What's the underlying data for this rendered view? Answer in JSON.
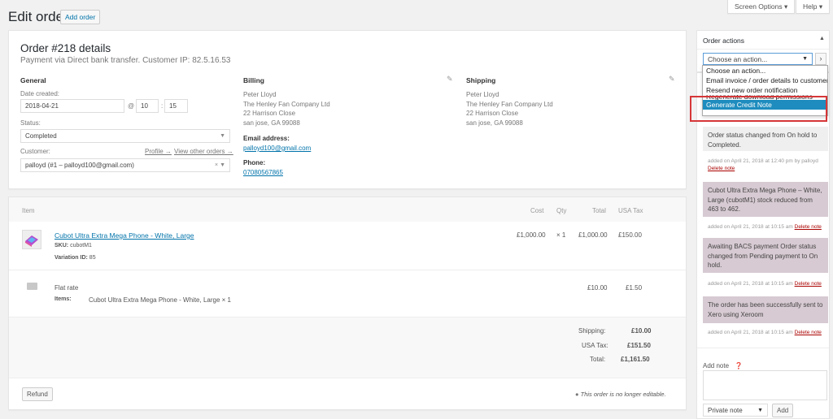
{
  "header": {
    "title": "Edit order",
    "add_order": "Add order",
    "screen_options": "Screen Options ▾",
    "help": "Help ▾"
  },
  "order": {
    "heading": "Order #218 details",
    "payment_line": "Payment via Direct bank transfer. Customer IP: 82.5.16.53",
    "general": {
      "title": "General",
      "date_label": "Date created:",
      "date_value": "2018-04-21",
      "at_symbol": "@",
      "hour": "10",
      "minute_sep": ":",
      "minute": "15",
      "status_label": "Status:",
      "status_value": "Completed",
      "customer_label": "Customer:",
      "profile_link": "Profile →",
      "other_orders_link": "View other orders →",
      "customer_value": "palloyd (#1 – palloyd100@gmail.com)"
    },
    "billing": {
      "title": "Billing",
      "lines": [
        "Peter Lloyd",
        "The Henley Fan Company Ltd",
        "22 Harrison Close",
        "san jose, GA 99088"
      ],
      "email_label": "Email address:",
      "email": "palloyd100@gmail.com",
      "phone_label": "Phone:",
      "phone": "07080567865"
    },
    "shipping": {
      "title": "Shipping",
      "lines": [
        "Peter Lloyd",
        "The Henley Fan Company Ltd",
        "22 Harrison Close",
        "san jose, GA 99088"
      ]
    }
  },
  "items": {
    "headers": {
      "item": "Item",
      "cost": "Cost",
      "qty": "Qty",
      "total": "Total",
      "tax": "USA Tax"
    },
    "product": {
      "name": "Cubot Ultra Extra Mega Phone - White, Large",
      "sku_label": "SKU:",
      "sku": "cubotM1",
      "variation_label": "Variation ID:",
      "variation": "85",
      "cost": "£1,000.00",
      "qty": "× 1",
      "total": "£1,000.00",
      "tax": "£150.00"
    },
    "shipping_line": {
      "name": "Flat rate",
      "items_label": "Items:",
      "items_value": "Cubot Ultra Extra Mega Phone - White, Large × 1",
      "total": "£10.00",
      "tax": "£1.50"
    },
    "totals": {
      "shipping_label": "Shipping:",
      "shipping_value": "£10.00",
      "tax_label": "USA Tax:",
      "tax_value": "£151.50",
      "total_label": "Total:",
      "total_value": "£1,161.50"
    },
    "refund": "Refund",
    "not_editable": "This order is no longer editable."
  },
  "order_actions": {
    "title": "Order actions",
    "select_value": "Choose an action...",
    "go": "›",
    "options": [
      "Choose an action...",
      "Email invoice / order details to customer",
      "Resend new order notification",
      "Regenerate download permissions",
      "Generate Credit Note"
    ],
    "highlight_color": "#d63638"
  },
  "notes": {
    "items": [
      {
        "text": "Order status changed from On hold to Completed.",
        "meta": "added on April 21, 2018 at 12:40 pm by palloyd",
        "delete": "Delete note"
      },
      {
        "text": "Cubot Ultra Extra Mega Phone – White, Large (cubotM1) stock reduced from 463 to 462.",
        "meta": "added on April 21, 2018 at 10:15 am",
        "delete": "Delete note"
      },
      {
        "text": "Awaiting BACS payment Order status changed from Pending payment to On hold.",
        "meta": "added on April 21, 2018 at 10:15 am",
        "delete": "Delete note"
      },
      {
        "text": "The order has been successfully sent to Xero using Xeroom",
        "meta": "added on April 21, 2018 at 10:15 am",
        "delete": "Delete note"
      }
    ],
    "add_note_label": "Add note",
    "note_type": "Private note",
    "add_button": "Add"
  }
}
